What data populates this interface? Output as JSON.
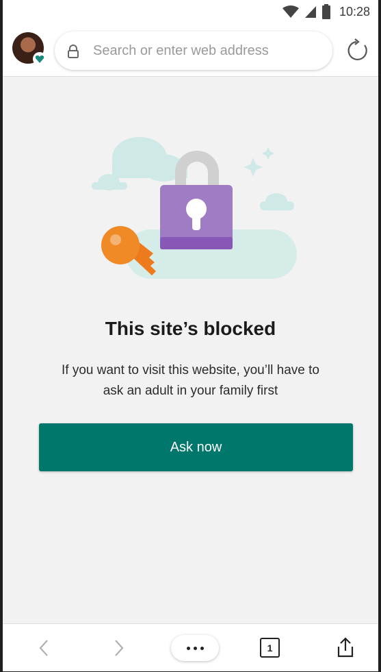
{
  "status_bar": {
    "time": "10:28"
  },
  "address_bar": {
    "placeholder": "Search or enter web address"
  },
  "blocked_page": {
    "title": "This site’s blocked",
    "message_line1": "If you want to visit this website, you’ll have to",
    "message_line2": "ask an adult in your family first",
    "button_label": "Ask now"
  },
  "bottom_bar": {
    "tab_count": "1"
  },
  "icons": {
    "wifi": "wifi-icon",
    "signal": "signal-icon",
    "battery": "battery-icon",
    "lock": "lock-icon",
    "refresh": "refresh-icon",
    "back": "back-icon",
    "forward": "forward-icon",
    "more": "more-icon",
    "tabs": "tabs-icon",
    "share": "share-icon"
  },
  "colors": {
    "accent": "#00776b",
    "lock_purple": "#a07cc5",
    "key_orange": "#ee7a1e"
  }
}
